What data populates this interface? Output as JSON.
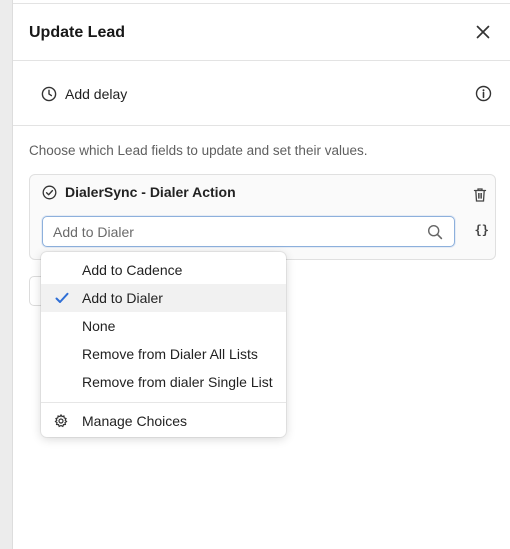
{
  "panel": {
    "title": "Update Lead",
    "close_icon": "close-icon"
  },
  "delay": {
    "label": "Add delay",
    "icon": "clock-icon",
    "info_icon": "info-icon"
  },
  "description": "Choose which Lead fields to update and set their values.",
  "field": {
    "title": "DialerSync - Dialer Action",
    "status_icon": "check-circle-icon",
    "delete_icon": "trash-icon",
    "search_value": "Add to Dialer",
    "variable_icon": "braces-icon",
    "variable_glyph": "{}"
  },
  "dropdown": {
    "options": [
      {
        "label": "Add to Cadence",
        "selected": false
      },
      {
        "label": "Add to Dialer",
        "selected": true
      },
      {
        "label": "None",
        "selected": false
      },
      {
        "label": "Remove from Dialer All Lists",
        "selected": false
      },
      {
        "label": "Remove from dialer Single List",
        "selected": false
      }
    ],
    "manage_label": "Manage Choices",
    "manage_icon": "gear-icon"
  },
  "colors": {
    "accent": "#2f6fd6",
    "selected_bg": "#f1f1f1",
    "input_border": "#8db0dc"
  }
}
